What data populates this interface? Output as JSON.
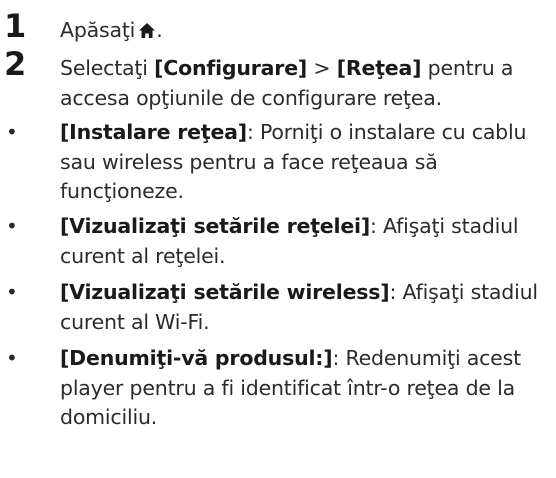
{
  "steps": [
    {
      "number": "1",
      "text_before": "Apăsaţi",
      "icon": "home-icon",
      "text_after": "."
    },
    {
      "number": "2",
      "text_1": "Selectaţi ",
      "term_1": "[Configurare]",
      "text_2": " > ",
      "term_2": "[Reţea]",
      "text_3": " pentru a accesa opţiunile de configurare reţea."
    }
  ],
  "bullets": [
    {
      "marker": "•",
      "term": "[Instalare reţea]",
      "text": ": Porniţi o instalare cu cablu sau wireless pentru a face reţeaua să funcţioneze."
    },
    {
      "marker": "•",
      "term": "[Vizualizaţi setările reţelei]",
      "text": ": Afişaţi stadiul curent al reţelei."
    },
    {
      "marker": "•",
      "term": "[Vizualizaţi setările wireless]",
      "text": ": Afişaţi stadiul curent al Wi-Fi."
    },
    {
      "marker": "•",
      "term": "[Denumiţi-vă produsul:]",
      "text": ": Redenumiţi acest player pentru a fi identificat într-o reţea de la domiciliu."
    }
  ],
  "colors": {
    "text": "#2b2b2b",
    "term": "#1a1a1a"
  }
}
